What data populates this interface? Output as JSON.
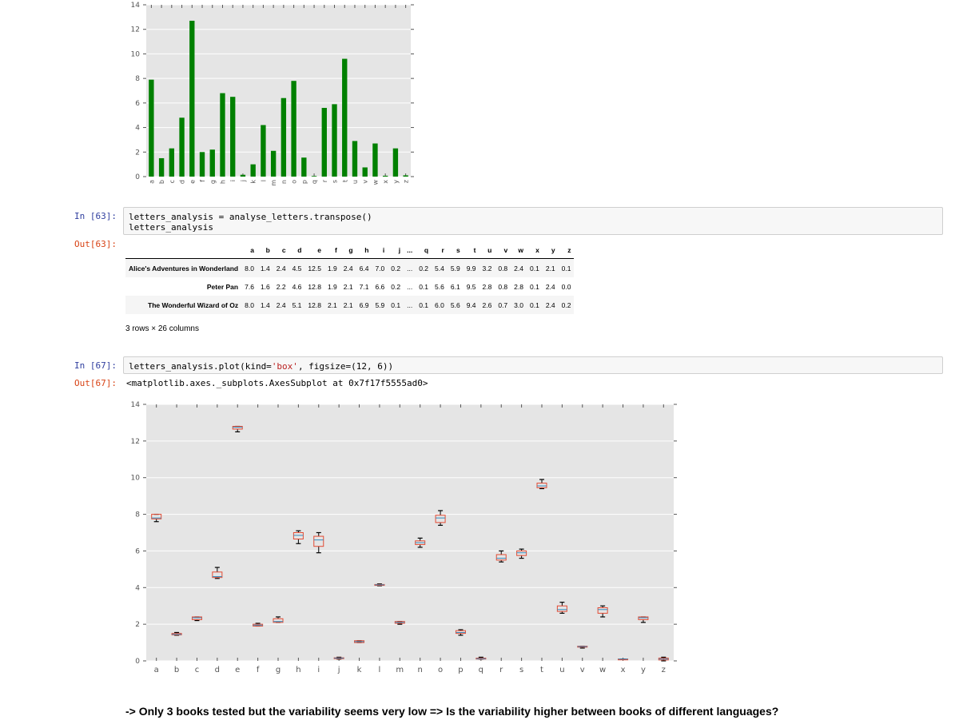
{
  "cells": {
    "in63": {
      "prompt_in": "In [63]:",
      "code_line1": "letters_analysis = analyse_letters.transpose()",
      "code_line2": "letters_analysis",
      "prompt_out": "Out[63]:"
    },
    "in67": {
      "prompt_in": "In [67]:",
      "code_prefix": "letters_analysis.plot(kind=",
      "code_string": "'box'",
      "code_suffix": ", figsize=(12, 6))",
      "prompt_out": "Out[67]:",
      "output_repr": "<matplotlib.axes._subplots.AxesSubplot at 0x7f17f5555ad0>"
    }
  },
  "dataframe": {
    "columns": [
      "a",
      "b",
      "c",
      "d",
      "e",
      "f",
      "g",
      "h",
      "i",
      "j",
      "...",
      "q",
      "r",
      "s",
      "t",
      "u",
      "v",
      "w",
      "x",
      "y",
      "z"
    ],
    "rows": [
      {
        "label": "Alice's Adventures in Wonderland",
        "values": [
          "8.0",
          "1.4",
          "2.4",
          "4.5",
          "12.5",
          "1.9",
          "2.4",
          "6.4",
          "7.0",
          "0.2",
          "...",
          "0.2",
          "5.4",
          "5.9",
          "9.9",
          "3.2",
          "0.8",
          "2.4",
          "0.1",
          "2.1",
          "0.1"
        ]
      },
      {
        "label": "Peter Pan",
        "values": [
          "7.6",
          "1.6",
          "2.2",
          "4.6",
          "12.8",
          "1.9",
          "2.1",
          "7.1",
          "6.6",
          "0.2",
          "...",
          "0.1",
          "5.6",
          "6.1",
          "9.5",
          "2.8",
          "0.8",
          "2.8",
          "0.1",
          "2.4",
          "0.0"
        ]
      },
      {
        "label": "The Wonderful Wizard of Oz",
        "values": [
          "8.0",
          "1.4",
          "2.4",
          "5.1",
          "12.8",
          "2.1",
          "2.1",
          "6.9",
          "5.9",
          "0.1",
          "...",
          "0.1",
          "6.0",
          "5.6",
          "9.4",
          "2.6",
          "0.7",
          "3.0",
          "0.1",
          "2.4",
          "0.2"
        ]
      }
    ],
    "shape_info": "3 rows × 26 columns"
  },
  "note": "-> Only 3 books tested but the variability seems very low => Is the variability higher between books of different languages?",
  "colors": {
    "bar": "#008000",
    "box": "#e24a33",
    "whisker": "#000000",
    "median": "#348abd",
    "plot_bg": "#e5e5e5",
    "grid": "#ffffff",
    "prompt_in": "#303f9f",
    "prompt_out": "#d84315"
  },
  "chart_data": [
    {
      "type": "bar",
      "categories": [
        "a",
        "b",
        "c",
        "d",
        "e",
        "f",
        "g",
        "h",
        "i",
        "j",
        "k",
        "l",
        "m",
        "n",
        "o",
        "p",
        "q",
        "r",
        "s",
        "t",
        "u",
        "v",
        "w",
        "x",
        "y",
        "z"
      ],
      "values": [
        7.9,
        1.5,
        2.3,
        4.8,
        12.7,
        2.0,
        2.2,
        6.8,
        6.5,
        0.15,
        1.0,
        4.2,
        2.1,
        6.4,
        7.8,
        1.55,
        0.05,
        5.6,
        5.9,
        9.6,
        2.9,
        0.75,
        2.7,
        0.07,
        2.3,
        0.1
      ],
      "ylim": [
        0,
        14
      ],
      "yticks": [
        "0",
        "2",
        "4",
        "6",
        "8",
        "10",
        "12",
        "14"
      ],
      "grid": true,
      "title": "",
      "xlabel": "",
      "ylabel": ""
    },
    {
      "type": "box",
      "categories": [
        "a",
        "b",
        "c",
        "d",
        "e",
        "f",
        "g",
        "h",
        "i",
        "j",
        "k",
        "l",
        "m",
        "n",
        "o",
        "p",
        "q",
        "r",
        "s",
        "t",
        "u",
        "v",
        "w",
        "x",
        "y",
        "z"
      ],
      "boxes": [
        {
          "min": 7.6,
          "q1": 7.75,
          "median": 7.8,
          "q3": 8.0,
          "max": 8.0
        },
        {
          "min": 1.4,
          "q1": 1.42,
          "median": 1.45,
          "q3": 1.5,
          "max": 1.55
        },
        {
          "min": 2.2,
          "q1": 2.25,
          "median": 2.35,
          "q3": 2.4,
          "max": 2.4
        },
        {
          "min": 4.5,
          "q1": 4.55,
          "median": 4.6,
          "q3": 4.85,
          "max": 5.1
        },
        {
          "min": 12.5,
          "q1": 12.65,
          "median": 12.75,
          "q3": 12.8,
          "max": 12.8
        },
        {
          "min": 1.9,
          "q1": 1.9,
          "median": 1.95,
          "q3": 2.0,
          "max": 2.05
        },
        {
          "min": 2.1,
          "q1": 2.1,
          "median": 2.15,
          "q3": 2.3,
          "max": 2.4
        },
        {
          "min": 6.4,
          "q1": 6.65,
          "median": 6.85,
          "q3": 7.0,
          "max": 7.1
        },
        {
          "min": 5.9,
          "q1": 6.25,
          "median": 6.6,
          "q3": 6.8,
          "max": 7.0
        },
        {
          "min": 0.1,
          "q1": 0.12,
          "median": 0.15,
          "q3": 0.17,
          "max": 0.2
        },
        {
          "min": 1.0,
          "q1": 1.0,
          "median": 1.05,
          "q3": 1.1,
          "max": 1.1
        },
        {
          "min": 4.1,
          "q1": 4.12,
          "median": 4.15,
          "q3": 4.17,
          "max": 4.2
        },
        {
          "min": 2.0,
          "q1": 2.05,
          "median": 2.1,
          "q3": 2.15,
          "max": 2.15
        },
        {
          "min": 6.2,
          "q1": 6.35,
          "median": 6.45,
          "q3": 6.55,
          "max": 6.7
        },
        {
          "min": 7.4,
          "q1": 7.55,
          "median": 7.8,
          "q3": 7.95,
          "max": 8.2
        },
        {
          "min": 1.4,
          "q1": 1.5,
          "median": 1.55,
          "q3": 1.65,
          "max": 1.7
        },
        {
          "min": 0.1,
          "q1": 0.1,
          "median": 0.12,
          "q3": 0.15,
          "max": 0.2
        },
        {
          "min": 5.4,
          "q1": 5.5,
          "median": 5.6,
          "q3": 5.8,
          "max": 6.0
        },
        {
          "min": 5.6,
          "q1": 5.75,
          "median": 5.9,
          "q3": 6.0,
          "max": 6.1
        },
        {
          "min": 9.4,
          "q1": 9.45,
          "median": 9.55,
          "q3": 9.7,
          "max": 9.9
        },
        {
          "min": 2.6,
          "q1": 2.7,
          "median": 2.8,
          "q3": 3.0,
          "max": 3.2
        },
        {
          "min": 0.7,
          "q1": 0.75,
          "median": 0.78,
          "q3": 0.8,
          "max": 0.8
        },
        {
          "min": 2.4,
          "q1": 2.6,
          "median": 2.8,
          "q3": 2.9,
          "max": 3.0
        },
        {
          "min": 0.1,
          "q1": 0.1,
          "median": 0.1,
          "q3": 0.1,
          "max": 0.1
        },
        {
          "min": 2.1,
          "q1": 2.25,
          "median": 2.35,
          "q3": 2.4,
          "max": 2.4
        },
        {
          "min": 0.0,
          "q1": 0.05,
          "median": 0.1,
          "q3": 0.15,
          "max": 0.2
        }
      ],
      "ylim": [
        0,
        14
      ],
      "yticks": [
        "0",
        "2",
        "4",
        "6",
        "8",
        "10",
        "12",
        "14"
      ],
      "grid": true,
      "title": "",
      "xlabel": "",
      "ylabel": ""
    }
  ]
}
